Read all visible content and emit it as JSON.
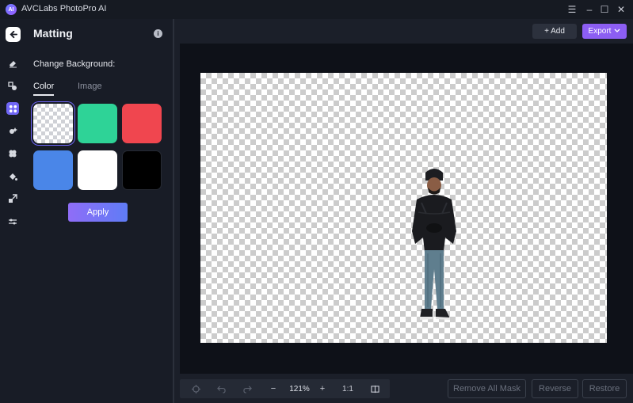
{
  "window": {
    "title": "AVCLabs PhotoPro AI",
    "logo_text": "AI",
    "controls": {
      "menu": "☰",
      "minimize": "–",
      "maximize": "☐",
      "close": "✕"
    }
  },
  "rail": {
    "items": [
      {
        "name": "eraser-icon"
      },
      {
        "name": "object-removal-icon"
      },
      {
        "name": "matting-icon",
        "active": true
      },
      {
        "name": "enhance-icon"
      },
      {
        "name": "colorize-icon"
      },
      {
        "name": "fill-icon"
      },
      {
        "name": "upscale-icon"
      },
      {
        "name": "adjust-icon"
      }
    ]
  },
  "panel": {
    "title": "Matting",
    "change_background_label": "Change Background:",
    "tabs": [
      {
        "label": "Color",
        "active": true
      },
      {
        "label": "Image",
        "active": false
      }
    ],
    "swatches": [
      {
        "color": "transparent",
        "selected": true
      },
      {
        "color": "#2ed397",
        "selected": false
      },
      {
        "color": "#f0464f",
        "selected": false
      },
      {
        "color": "#4a86e8",
        "selected": false
      },
      {
        "color": "#ffffff",
        "selected": false
      },
      {
        "color": "#000000",
        "selected": false
      }
    ],
    "apply_label": "Apply"
  },
  "toolbar": {
    "add_label": "+ Add",
    "export_label": "Export",
    "export_chevron": "⌄"
  },
  "bottom": {
    "zoom_label": "121%",
    "ratio_label": "1:1",
    "zoom_out": "−",
    "zoom_in": "+",
    "remove_all_mask": "Remove All Mask",
    "reverse": "Reverse",
    "restore": "Restore"
  },
  "colors": {
    "accent": "#6f66f5",
    "export": "#8c5ef3",
    "background": "#171b24"
  }
}
